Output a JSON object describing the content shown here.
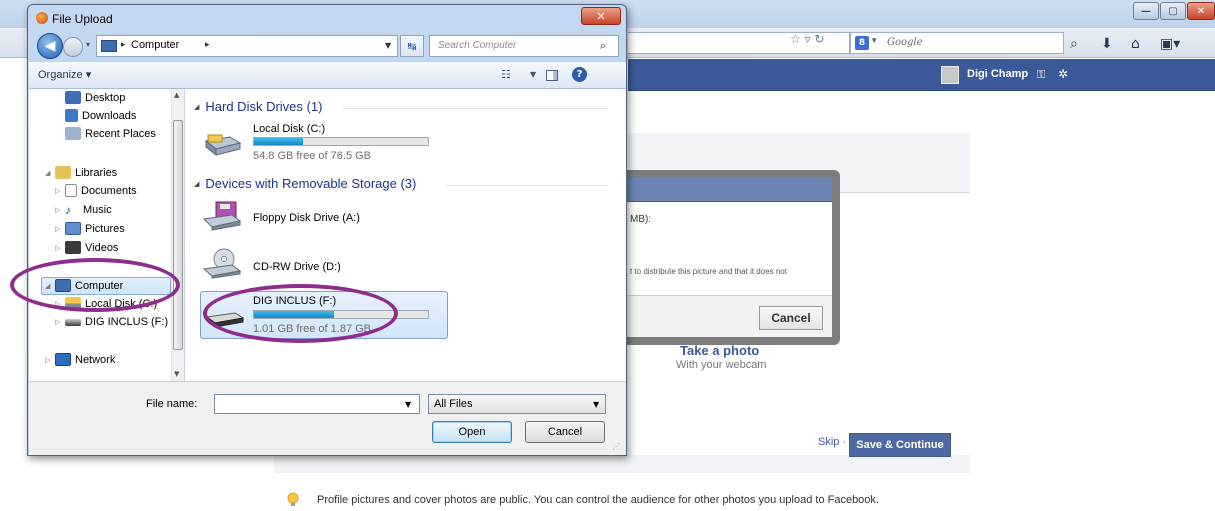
{
  "browser": {
    "search_engine": "Google",
    "min_icon": "—",
    "max_icon": "▢",
    "close_icon": "✕"
  },
  "facebook": {
    "username": "Digi Champ",
    "dialog_fragment_1": "MB):",
    "dialog_fragment_2": "t to distribute this picture and that it does not",
    "cancel_label": "Cancel",
    "take_photo_title": "Take a photo",
    "take_photo_sub": "With your webcam",
    "skip_label": "Skip ·",
    "save_continue_label": "Save & Continue",
    "tip_text": "Profile pictures and cover photos are public. You can control the audience for other photos you upload to Facebook."
  },
  "dialog": {
    "title": "File Upload",
    "close_icon": "✕",
    "address": {
      "location": "Computer",
      "separator": "▸"
    },
    "search_placeholder": "Search Computer",
    "toolbar": {
      "organize_label": "Organize ▾",
      "help_icon": "?"
    },
    "nav": {
      "desktop": "Desktop",
      "downloads": "Downloads",
      "recent_places": "Recent Places",
      "libraries": "Libraries",
      "documents": "Documents",
      "music": "Music",
      "pictures": "Pictures",
      "videos": "Videos",
      "computer": "Computer",
      "local_disk": "Local Disk (C:)",
      "dig_inclus": "DIG INCLUS (F:)",
      "network": "Network"
    },
    "content": {
      "hard_disk_header": "Hard Disk Drives (1)",
      "removable_header": "Devices with Removable Storage (3)",
      "drives": {
        "c": {
          "label": "Local Disk (C:)",
          "free_text": "54.8 GB free of 76.5 GB",
          "used_fraction": 0.28
        },
        "a": {
          "label": "Floppy Disk Drive (A:)"
        },
        "d": {
          "label": "CD-RW Drive (D:)"
        },
        "f": {
          "label": "DIG INCLUS (F:)",
          "free_text": "1.01 GB free of 1.87 GB",
          "used_fraction": 0.46
        }
      }
    },
    "bottom": {
      "filename_label": "File name:",
      "filename_value": "",
      "filetype_value": "All Files",
      "open_label": "Open",
      "cancel_label": "Cancel"
    }
  },
  "annotations": {
    "color": "#8e2d8c"
  }
}
